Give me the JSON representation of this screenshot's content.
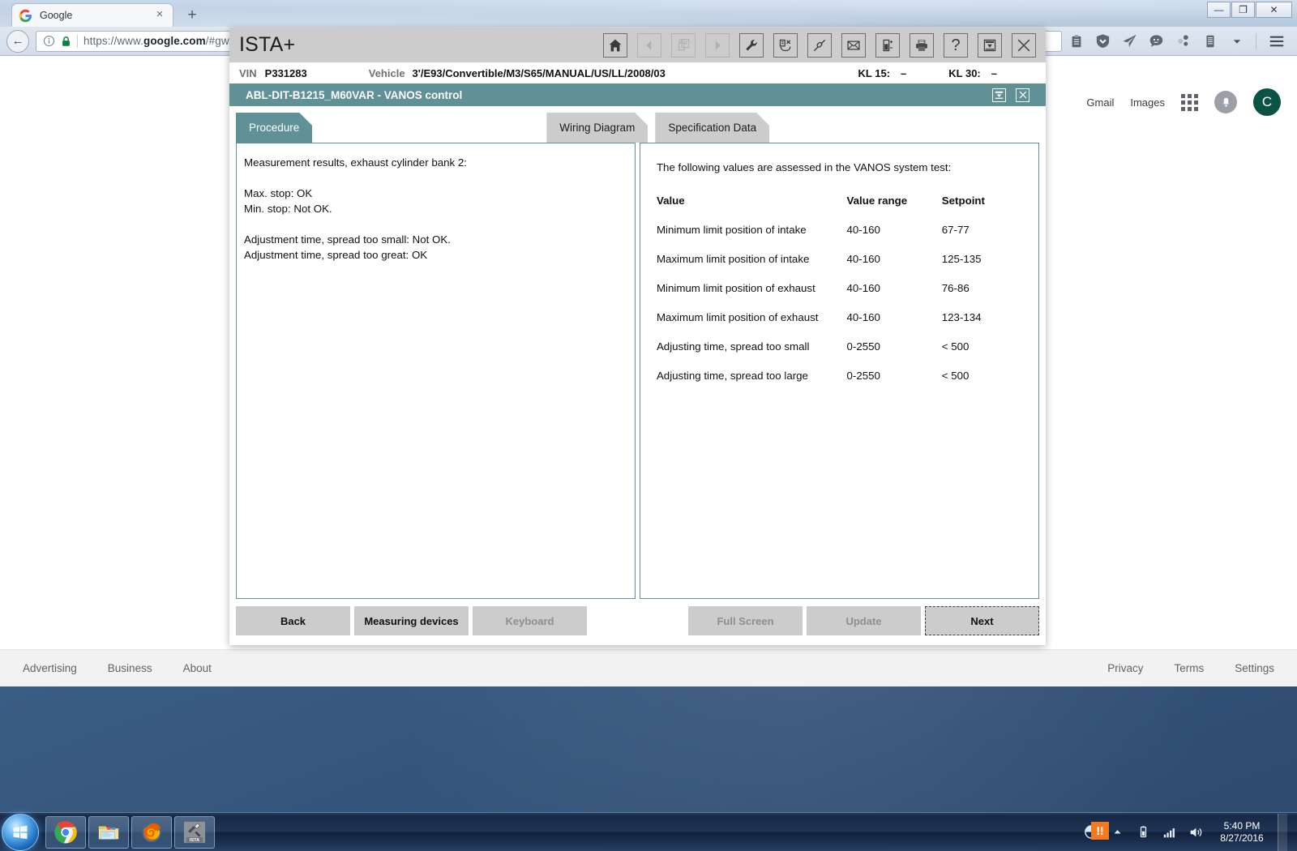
{
  "browser": {
    "tab": {
      "title": "Google",
      "favicon": "google-icon",
      "close": "×"
    },
    "newtab_label": "+",
    "window_controls": {
      "minimize": "—",
      "maximize": "❐",
      "close": "✕"
    },
    "back_arrow": "←",
    "url": {
      "protocol": "https://www.",
      "domain": "google.com",
      "path": "/#gws_rd=ss"
    },
    "extensions": [
      "clipboard-icon",
      "shield-down-icon",
      "paper-plane-icon",
      "chat-bubble-icon",
      "molecule-icon",
      "document-icon",
      "chevron-down-icon"
    ],
    "menu_icon": "hamburger-menu-icon"
  },
  "google": {
    "links": [
      "Gmail",
      "Images"
    ],
    "apps_icon": "apps-grid-icon",
    "bell_icon": "bell-icon",
    "avatar_letter": "C",
    "footer_left": [
      "Advertising",
      "Business",
      "About"
    ],
    "footer_right": [
      "Privacy",
      "Terms",
      "Settings"
    ]
  },
  "ista": {
    "logo": "ISTA+",
    "toolbar_icons": [
      {
        "name": "home-icon",
        "enabled": true
      },
      {
        "name": "back-arrow-icon",
        "enabled": false
      },
      {
        "name": "documents-icon",
        "enabled": false
      },
      {
        "name": "forward-arrow-icon",
        "enabled": false
      },
      {
        "name": "wrench-icon",
        "enabled": true
      },
      {
        "name": "delete-session-icon",
        "enabled": true
      },
      {
        "name": "plug-icon",
        "enabled": true
      },
      {
        "name": "mail-icon",
        "enabled": true
      },
      {
        "name": "battery-icon",
        "enabled": true
      },
      {
        "name": "printer-icon",
        "enabled": true
      },
      {
        "name": "help-icon",
        "enabled": true
      },
      {
        "name": "minimize-box-icon",
        "enabled": true
      },
      {
        "name": "close-icon",
        "enabled": true
      }
    ],
    "vin_label": "VIN",
    "vin_value": "P331283",
    "vehicle_label": "Vehicle",
    "vehicle_value": "3'/E93/Convertible/M3/S65/MANUAL/US/LL/2008/03",
    "kl15_label": "KL 15:",
    "kl15_value": "–",
    "kl30_label": "KL 30:",
    "kl30_value": "–",
    "window_title": "ABL-DIT-B1215_M60VAR  -  VANOS control",
    "title_icons": [
      "minimize-icon",
      "close-icon"
    ],
    "tabs": [
      {
        "label": "Procedure",
        "active": true
      },
      {
        "label": "Wiring Diagram",
        "active": false
      },
      {
        "label": "Specification Data",
        "active": false
      }
    ],
    "left_pane_text": "Measurement results, exhaust cylinder bank 2:\n\nMax. stop: OK\nMin. stop: Not OK.\n\nAdjustment time, spread too small: Not OK.\nAdjustment time, spread too great: OK",
    "right_pane": {
      "intro": "The following values are assessed in the VANOS system test:",
      "headers": [
        "Value",
        "Value range",
        "Setpoint"
      ],
      "rows": [
        [
          "Minimum limit position of intake",
          "40-160",
          "67-77"
        ],
        [
          "Maximum limit position of intake",
          "40-160",
          "125-135"
        ],
        [
          "Minimum limit position of exhaust",
          "40-160",
          "76-86"
        ],
        [
          "Maximum limit position of exhaust",
          "40-160",
          "123-134"
        ],
        [
          "Adjusting time, spread too small",
          "0-2550",
          "< 500"
        ],
        [
          "Adjusting time, spread too large",
          "0-2550",
          "< 500"
        ]
      ]
    },
    "buttons": [
      {
        "label": "Back",
        "state": "enabled"
      },
      {
        "label": "Measuring devices",
        "state": "enabled"
      },
      {
        "label": "Keyboard",
        "state": "disabled"
      },
      {
        "label": "Full Screen",
        "state": "disabled"
      },
      {
        "label": "Update",
        "state": "disabled"
      },
      {
        "label": "Next",
        "state": "focused"
      }
    ],
    "accent_color": "#5f9197",
    "chrome_color": "#cccccc"
  },
  "taskbar": {
    "start_icon": "windows-start-icon",
    "items": [
      "chrome-icon",
      "explorer-icon",
      "firefox-icon",
      "ista-icon"
    ],
    "ista_label": "ISTA",
    "tray": {
      "action_center": "action-center-icon",
      "warning_badge": "!!",
      "overflow_arrow": "▲",
      "battery": "battery-icon",
      "network": "signal-bars-icon",
      "volume": "volume-icon"
    },
    "time": "5:40 PM",
    "date": "8/27/2016"
  }
}
